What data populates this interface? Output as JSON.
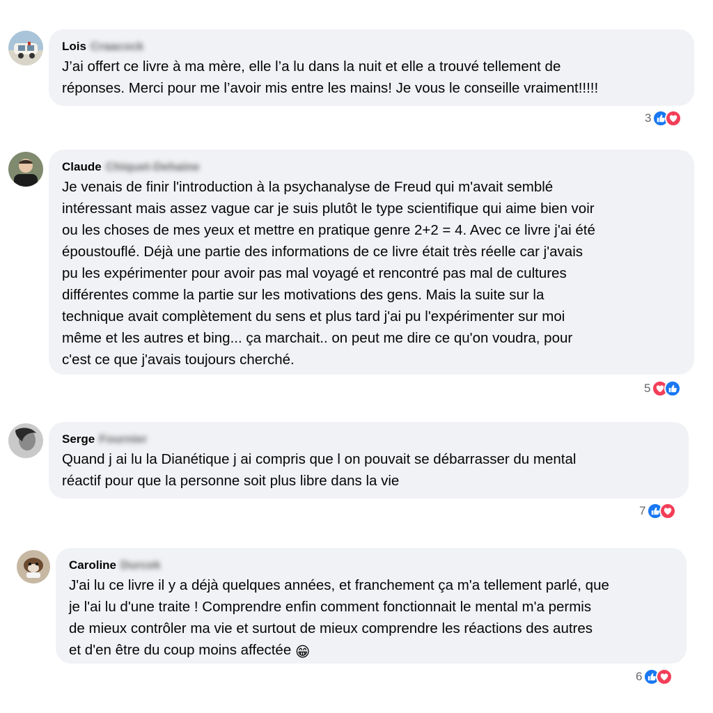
{
  "comments": [
    {
      "author_first": "Lois",
      "author_last": "Craacock",
      "lines": [
        "J’ai offert ce livre à ma mère, elle l’a lu dans la nuit et elle a trouvé tellement de",
        "réponses. Merci pour me l’avoir mis entre les mains! Je vous le conseille vraiment!!!!!"
      ],
      "reaction_count": "3",
      "reactions": [
        "like-icon",
        "love-icon"
      ]
    },
    {
      "author_first": "Claude",
      "author_last": "Chiquet-Dehaine",
      "lines": [
        "Je venais de finir l'introduction à la psychanalyse de Freud qui m'avait semblé",
        "intéressant mais assez vague car je suis plutôt le type scientifique qui aime bien voir",
        "ou les choses de mes yeux et mettre en pratique genre 2+2 = 4. Avec ce livre j'ai été",
        "époustouflé. Déjà une partie des informations de ce livre était très réelle car j'avais",
        "pu les expérimenter pour avoir pas mal voyagé et rencontré pas mal de cultures",
        "différentes comme la partie sur les motivations des gens. Mais la suite sur la",
        "technique avait complètement du sens et plus tard j'ai pu l'expérimenter sur moi",
        "même et les autres et bing... ça marchait.. on peut me dire ce qu'on voudra, pour",
        "c'est ce que j'avais toujours cherché."
      ],
      "reaction_count": "5",
      "reactions": [
        "love-icon",
        "like-icon"
      ]
    },
    {
      "author_first": "Serge",
      "author_last": "Fournier",
      "lines": [
        "Quand j ai lu la Dianétique j ai compris que l on pouvait se débarrasser du mental",
        "réactif pour que la personne soit plus libre dans la vie"
      ],
      "reaction_count": "7",
      "reactions": [
        "like-icon",
        "love-icon"
      ]
    },
    {
      "author_first": "Caroline",
      "author_last": "Durcek",
      "lines": [
        "J'ai lu ce livre il y a déjà quelques années, et franchement ça m'a tellement parlé, que",
        "je l'ai lu d'une traite ! Comprendre enfin comment fonctionnait le mental m'a permis",
        "de mieux contrôler ma vie et surtout de mieux comprendre les réactions des autres",
        "et d'en être du coup moins affectée"
      ],
      "emoji": "😁",
      "reaction_count": "6",
      "reactions": [
        "like-icon",
        "love-icon"
      ]
    }
  ],
  "colors": {
    "bubble": "#f0f2f5",
    "like": "#1877f2",
    "love": "#f33e58",
    "muted": "#65676b"
  }
}
